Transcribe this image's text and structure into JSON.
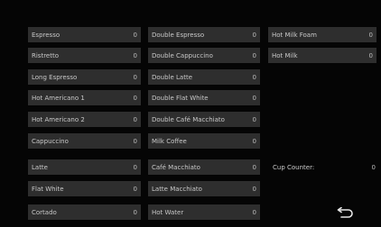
{
  "columns": [
    [
      {
        "label": "Espresso",
        "count": "0"
      },
      {
        "label": "Ristretto",
        "count": "0"
      },
      {
        "label": "Long Espresso",
        "count": "0"
      },
      {
        "label": "Hot Americano 1",
        "count": "0"
      },
      {
        "label": "Hot Americano 2",
        "count": "0"
      },
      {
        "label": "Cappuccino",
        "count": "0"
      },
      {
        "label": "Latte",
        "count": "0"
      },
      {
        "label": "Flat White",
        "count": "0"
      },
      {
        "label": "Cortado",
        "count": "0"
      }
    ],
    [
      {
        "label": "Double Espresso",
        "count": "0"
      },
      {
        "label": "Double Cappuccino",
        "count": "0"
      },
      {
        "label": "Double Latte",
        "count": "0"
      },
      {
        "label": "Double Flat White",
        "count": "0"
      },
      {
        "label": "Double Café Macchiato",
        "count": "0"
      },
      {
        "label": "Milk Coffee",
        "count": "0"
      },
      {
        "label": "Café Macchiato",
        "count": "0"
      },
      {
        "label": "Latte Macchiato",
        "count": "0"
      },
      {
        "label": "Hot Water",
        "count": "0"
      }
    ],
    [
      {
        "label": "Hot Milk Foam",
        "count": "0"
      },
      {
        "label": "Hot Milk",
        "count": "0"
      }
    ]
  ],
  "cup_counter": {
    "label": "Cup Counter:",
    "count": "0"
  },
  "back_icon": "return-arrow-icon"
}
